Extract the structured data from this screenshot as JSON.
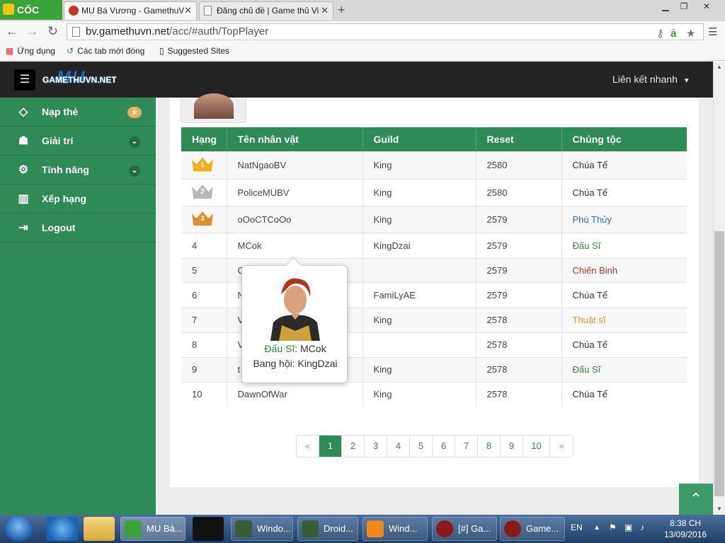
{
  "browser": {
    "brand": "CỐC CỐC",
    "tabs": [
      {
        "title": "MU Bá Vương - GamethuV"
      },
      {
        "title": "Đăng chủ đề | Game thủ Vi"
      }
    ],
    "url_domain": "bv.gamethuvn.net",
    "url_path": "/acc/#auth/TopPlayer",
    "bookmarks": [
      {
        "label": "Ứng dụng"
      },
      {
        "label": "Các tab mới đóng"
      },
      {
        "label": "Suggested Sites"
      }
    ]
  },
  "header": {
    "logo_text": "GAMETHUVN.NET",
    "logo_mu": "MU",
    "quicklink_label": "Liên kết nhanh"
  },
  "sidebar": {
    "items": [
      {
        "label": "Nạp thẻ",
        "icon": "diamond-icon"
      },
      {
        "label": "Giải trí",
        "icon": "android-icon"
      },
      {
        "label": "Tính năng",
        "icon": "gears-icon"
      },
      {
        "label": "Xếp hạng",
        "icon": "bar-chart-icon"
      },
      {
        "label": "Logout",
        "icon": "logout-icon"
      }
    ]
  },
  "table": {
    "columns": [
      "Hạng",
      "Tên nhân vật",
      "Guild",
      "Reset",
      "Chủng tộc"
    ],
    "rows": [
      {
        "rank": "1",
        "name": "NatNgaoBV",
        "guild": "King",
        "reset": "2580",
        "race": "Chúa Tể",
        "race_color": "#333333"
      },
      {
        "rank": "2",
        "name": "PoliceMUBV",
        "guild": "King",
        "reset": "2580",
        "race": "Chúa Tể",
        "race_color": "#333333"
      },
      {
        "rank": "3",
        "name": "oOoCTCoOo",
        "guild": "King",
        "reset": "2579",
        "race": "Phù Thủy",
        "race_color": "#2a6fc9"
      },
      {
        "rank": "4",
        "name": "MCok",
        "guild": "KingDzai",
        "reset": "2579",
        "race": "Đấu Sĩ",
        "race_color": "#2e8b2e"
      },
      {
        "rank": "5",
        "name": "C",
        "guild": "",
        "reset": "2579",
        "race": "Chiến Binh",
        "race_color": "#a33a2a"
      },
      {
        "rank": "6",
        "name": "N",
        "guild": "FamiLyAE",
        "reset": "2579",
        "race": "Chúa Tể",
        "race_color": "#333333"
      },
      {
        "rank": "7",
        "name": "V",
        "guild": "King",
        "reset": "2578",
        "race": "Thuật sĩ",
        "race_color": "#e09a2a"
      },
      {
        "rank": "8",
        "name": "V",
        "guild": "",
        "reset": "2578",
        "race": "Chúa Tể",
        "race_color": "#333333"
      },
      {
        "rank": "9",
        "name": "t",
        "guild": "King",
        "reset": "2578",
        "race": "Đấu Sĩ",
        "race_color": "#2e8b2e"
      },
      {
        "rank": "10",
        "name": "DawnOfWar",
        "guild": "King",
        "reset": "2578",
        "race": "Chúa Tể",
        "race_color": "#333333"
      }
    ]
  },
  "pagination": {
    "prev": "«",
    "pages": [
      "1",
      "2",
      "3",
      "4",
      "5",
      "6",
      "7",
      "8",
      "9",
      "10"
    ],
    "current": "1",
    "next": "»"
  },
  "tooltip": {
    "race": "Đấu Sĩ",
    "name": "MCok",
    "guild_label": "Bang hội",
    "guild": "KingDzai",
    "race_color": "#2e8b2e"
  },
  "taskbar": {
    "items": [
      {
        "label": "MU Bá..."
      },
      {
        "label": "Windo..."
      },
      {
        "label": "Droid..."
      },
      {
        "label": "Wind..."
      },
      {
        "label": "[#] Ga..."
      },
      {
        "label": "Game..."
      }
    ],
    "lang": "EN",
    "time": "8:38 CH",
    "date": "13/09/2016"
  },
  "colors": {
    "primary_green": "#2e8b57",
    "header_dark": "#242424"
  }
}
